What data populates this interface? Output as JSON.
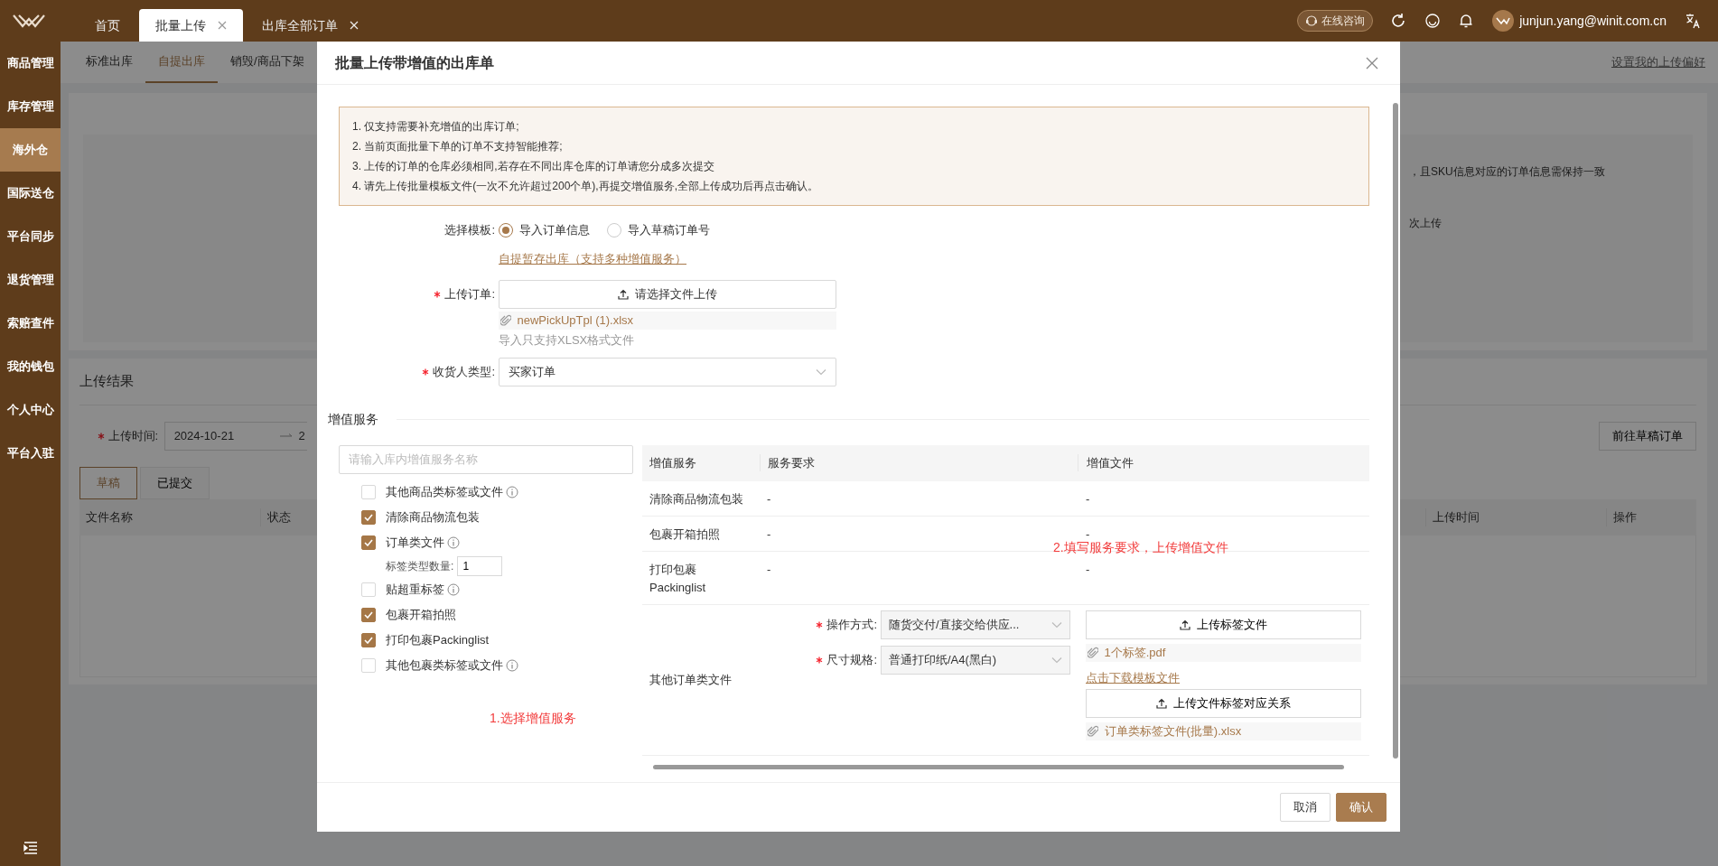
{
  "top_bar": {
    "tabs": [
      {
        "label": "首页",
        "selected": false,
        "closable": false
      },
      {
        "label": "批量上传",
        "selected": true,
        "closable": true
      },
      {
        "label": "出库全部订单",
        "selected": false,
        "closable": true
      }
    ],
    "consult_button": "在线咨询",
    "user_email": "junjun.yang@winit.com.cn"
  },
  "sidebar": {
    "items": [
      {
        "label": "商品管理",
        "selected": false
      },
      {
        "label": "库存管理",
        "selected": false
      },
      {
        "label": "海外仓",
        "selected": true
      },
      {
        "label": "国际送仓",
        "selected": false
      },
      {
        "label": "平台同步",
        "selected": false
      },
      {
        "label": "退货管理",
        "selected": false
      },
      {
        "label": "索赔查件",
        "selected": false
      },
      {
        "label": "我的钱包",
        "selected": false
      },
      {
        "label": "个人中心",
        "selected": false
      },
      {
        "label": "平台入驻",
        "selected": false
      }
    ]
  },
  "page": {
    "tabs": [
      {
        "label": "标准出库",
        "selected": false
      },
      {
        "label": "自提出库",
        "selected": true
      },
      {
        "label": "销毁/商品下架",
        "selected": false
      }
    ],
    "preference_link": "设置我的上传偏好",
    "notice_lines": [
      "，且SKU信息对应的订单信息需保持一致",
      "次上传"
    ],
    "results": {
      "title": "上传结果",
      "time_label": "上传时间:",
      "start_date": "2024-10-21",
      "end_date": "2",
      "draft_button": "前往草稿订单",
      "tabs": [
        {
          "label": "草稿",
          "selected": true
        },
        {
          "label": "已提交",
          "selected": false
        }
      ],
      "columns": [
        "文件名称",
        "状态",
        "上传时间",
        "操作"
      ]
    }
  },
  "modal": {
    "title": "批量上传带增值的出库单",
    "notice": [
      "1. 仅支持需要补充增值的出库订单;",
      "2. 当前页面批量下单的订单不支持智能推荐;",
      "3. 上传的订单的仓库必须相同,若存在不同出库仓库的订单请您分成多次提交",
      "4. 请先上传批量模板文件(一次不允许超过200个单),再提交增值服务,全部上传成功后再点击确认。"
    ],
    "template": {
      "label": "选择模板:",
      "options": [
        {
          "label": "导入订单信息",
          "selected": true
        },
        {
          "label": "导入草稿订单号",
          "selected": false
        }
      ],
      "link": "自提暂存出库（支持多种增值服务）"
    },
    "upload": {
      "label": "上传订单:",
      "required": true,
      "button": "请选择文件上传",
      "file": "newPickUpTpl (1).xlsx",
      "hint": "导入只支持XLSX格式文件"
    },
    "receiver": {
      "label": "收货人类型:",
      "required": true,
      "value": "买家订单"
    },
    "vas": {
      "title": "增值服务",
      "search": {
        "placeholder": "请输入库内增值服务名称"
      },
      "options": [
        {
          "label": "其他商品类标签或文件",
          "checked": false,
          "info": true
        },
        {
          "label": "清除商品物流包装",
          "checked": true,
          "info": false
        },
        {
          "label": "订单类文件",
          "checked": true,
          "info": true,
          "quantity": {
            "label": "标签类型数量:",
            "value": "1"
          }
        },
        {
          "label": "贴超重标签",
          "checked": false,
          "info": true
        },
        {
          "label": "包裹开箱拍照",
          "checked": true,
          "info": false
        },
        {
          "label": "打印包裹Packinglist",
          "checked": true,
          "info": false
        },
        {
          "label": "其他包裹类标签或文件",
          "checked": false,
          "info": true
        }
      ],
      "annotation": "1.选择增值服务",
      "table": {
        "columns": [
          "增值服务",
          "服务要求",
          "增值文件"
        ],
        "annotation": "2.填写服务要求，上传增值文件",
        "rows": [
          {
            "kind": "text",
            "service": "清除商品物流包装",
            "requirement": "-",
            "file": "-"
          },
          {
            "kind": "text",
            "service": "包裹开箱拍照",
            "requirement": "-",
            "file": "-"
          },
          {
            "kind": "text",
            "service": "打印包裹Packinglist",
            "requirement": "-",
            "file": "-"
          },
          {
            "kind": "form",
            "service": "其他订单类文件",
            "fields": [
              {
                "label": "操作方式:",
                "required": true,
                "value": "随货交付/直接交给供应..."
              },
              {
                "label": "尺寸规格:",
                "required": true,
                "value": "普通打印纸/A4(黑白)"
              }
            ],
            "uploads": [
              {
                "button": "上传标签文件",
                "file": "1个标签.pdf"
              },
              {
                "link": "点击下载模板文件",
                "button": "上传文件标签对应关系",
                "file": "订单类标签文件(批量).xlsx"
              }
            ]
          }
        ]
      }
    },
    "buttons": [
      {
        "label": "取消",
        "kind": "secondary"
      },
      {
        "label": "确认",
        "kind": "primary"
      }
    ]
  }
}
